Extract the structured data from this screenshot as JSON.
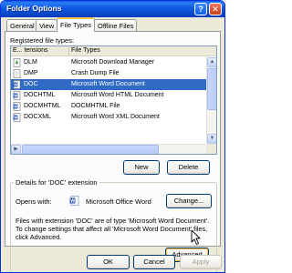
{
  "window": {
    "title": "Folder Options",
    "help_glyph": "?",
    "close_glyph": "✕"
  },
  "tabs": [
    {
      "label": "General",
      "active": false
    },
    {
      "label": "View",
      "active": false
    },
    {
      "label": "File Types",
      "active": true
    },
    {
      "label": "Offline Files",
      "active": false
    }
  ],
  "file_types": {
    "label": "Registered file types:",
    "columns": [
      "E... tensions",
      "File Types"
    ],
    "rows": [
      {
        "ext": "DLM",
        "type": "Microsoft Download Manager",
        "selected": false,
        "icon": "download-file-icon"
      },
      {
        "ext": "DMP",
        "type": "Crash Dump File",
        "selected": false,
        "icon": "generic-file-icon"
      },
      {
        "ext": "DOC",
        "type": "Microsoft Word Document",
        "selected": true,
        "icon": "word-doc-icon"
      },
      {
        "ext": "DOCHTML",
        "type": "Microsoft Word HTML Document",
        "selected": false,
        "icon": "word-doc-icon"
      },
      {
        "ext": "DOCMHTML",
        "type": "DOCMHTML File",
        "selected": false,
        "icon": "word-doc-icon"
      },
      {
        "ext": "DOCXML",
        "type": "Microsoft Word XML Document",
        "selected": false,
        "icon": "word-doc-icon"
      }
    ]
  },
  "buttons": {
    "new": "New",
    "delete": "Delete",
    "change": "Change...",
    "advanced": "Advanced",
    "ok": "OK",
    "cancel": "Cancel",
    "apply": "Apply"
  },
  "details": {
    "label": "Details for 'DOC' extension",
    "opens_with_label": "Opens with:",
    "opens_with_app": "Microsoft Office Word",
    "description": "Files with extension 'DOC' are of type 'Microsoft Word Document'. To change settings that affect all 'Microsoft Word Document' files, click Advanced."
  },
  "colors": {
    "title_bar": "#0a47c9",
    "selection": "#316ac5",
    "tab_highlight": "#ffc83c"
  }
}
